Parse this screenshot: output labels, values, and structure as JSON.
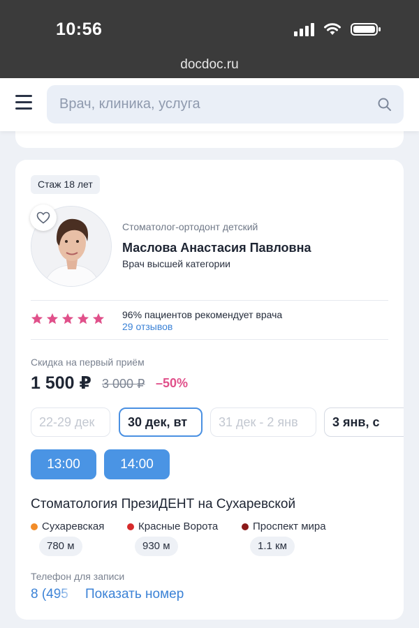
{
  "status_bar": {
    "time": "10:56"
  },
  "browser": {
    "url": "docdoc.ru"
  },
  "search": {
    "placeholder": "Врач, клиника, услуга"
  },
  "doctor": {
    "experience": "Стаж 18 лет",
    "specialty": "Стоматолог-ортодонт детский",
    "name": "Маслова Анастасия Павловна",
    "category": "Врач высшей категории",
    "rating_stars": 5,
    "recommend_text": "96% пациентов рекомендует врача",
    "reviews": "29 отзывов"
  },
  "pricing": {
    "label": "Скидка на первый приём",
    "price": "1 500 ₽",
    "old_price": "3 000 ₽",
    "discount": "–50%"
  },
  "dates": [
    {
      "label": "22-29 дек"
    },
    {
      "label": "30 дек, вт"
    },
    {
      "label": "31 дек - 2 янв"
    },
    {
      "label": "3 янв, с"
    }
  ],
  "slots": [
    "13:00",
    "14:00"
  ],
  "clinic": {
    "name": "Стоматология ПрезиДЕНТ на Сухаревской",
    "metro": [
      {
        "name": "Сухаревская",
        "distance": "780 м",
        "color": "#f28c28"
      },
      {
        "name": "Красные Ворота",
        "distance": "930 м",
        "color": "#d62b2b"
      },
      {
        "name": "Проспект мира",
        "distance": "1.1 км",
        "color": "#8b1a1a"
      }
    ]
  },
  "phone": {
    "label": "Телефон для записи",
    "number_partial": "8 (495",
    "show_label": "Показать номер"
  },
  "colors": {
    "accent": "#4a94e4",
    "link": "#3b82d6",
    "discount": "#e0508a",
    "star": "#e0508a"
  }
}
